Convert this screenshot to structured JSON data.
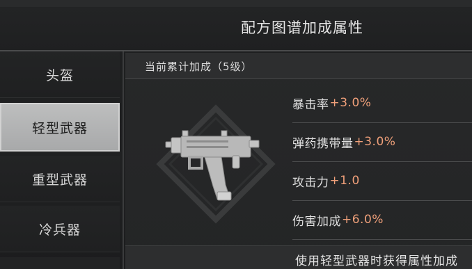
{
  "header": {
    "title": "配方图谱加成属性"
  },
  "sidebar": {
    "items": [
      {
        "label": "头盔",
        "active": false
      },
      {
        "label": "轻型武器",
        "active": true
      },
      {
        "label": "重型武器",
        "active": false
      },
      {
        "label": "冷兵器",
        "active": false
      }
    ]
  },
  "content": {
    "subheader": "当前累计加成（5级）",
    "weapon_icon": "submachine-gun-icon",
    "stats": [
      {
        "name": "暴击率",
        "value": "+3.0%"
      },
      {
        "name": "弹药携带量",
        "value": "+3.0%"
      },
      {
        "name": "攻击力",
        "value": "+1.0"
      },
      {
        "name": "伤害加成",
        "value": "+6.0%"
      }
    ],
    "footer": "使用轻型武器时获得属性加成"
  },
  "colors": {
    "accent_value": "#f0a07a",
    "active_tab_bg": "#bdbebe",
    "background": "#1d1e1f"
  }
}
